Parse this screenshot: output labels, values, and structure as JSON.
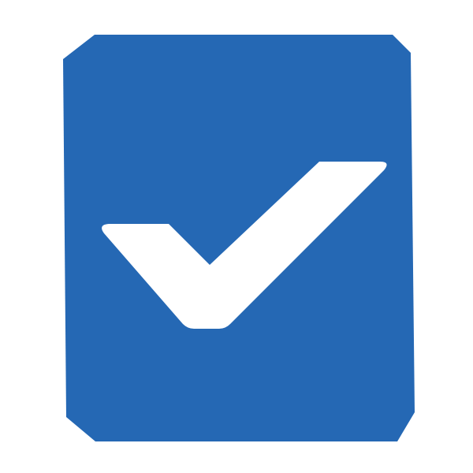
{
  "icon": {
    "name": "checked-checkbox-icon",
    "state": "checked",
    "box_color": "#2568B4",
    "check_color": "#FFFFFF",
    "background_color": "#FFFFFF"
  }
}
